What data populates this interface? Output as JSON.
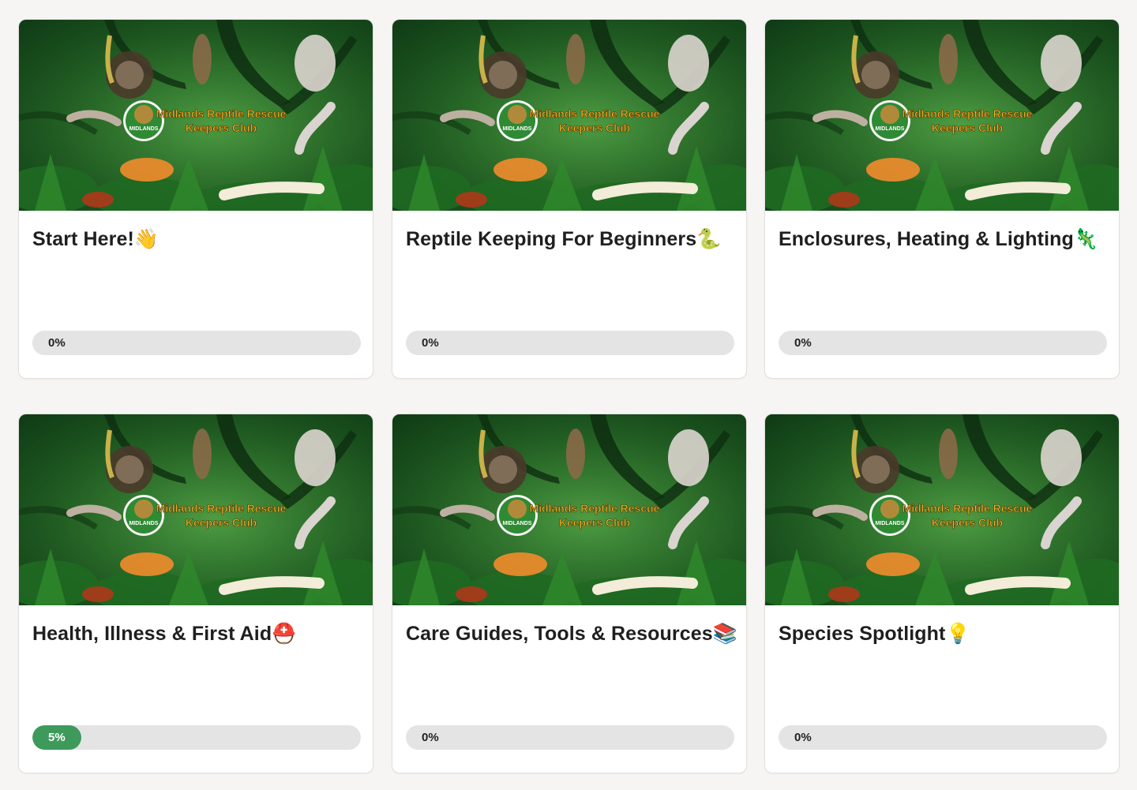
{
  "colors": {
    "page_bg": "#f6f5f4",
    "progress_fill": "#3d9a5b",
    "progress_track": "#e4e4e4",
    "banner_green": "#2a6e29",
    "banner_text": "#f0b429"
  },
  "banner": {
    "line1": "Midlands Reptile Rescue",
    "line2": "Keepers Club",
    "badge_text": "MIDLANDS"
  },
  "courses": [
    {
      "title": "Start Here!👋",
      "progress_label": "0%",
      "progress": 0
    },
    {
      "title": "Reptile Keeping For Beginners🐍",
      "progress_label": "0%",
      "progress": 0
    },
    {
      "title": "Enclosures, Heating & Lighting🦎",
      "progress_label": "0%",
      "progress": 0
    },
    {
      "title": "Health, Illness & First Aid⛑️",
      "progress_label": "5%",
      "progress": 0.05
    },
    {
      "title": "Care Guides, Tools & Resources📚",
      "progress_label": "0%",
      "progress": 0
    },
    {
      "title": "Species Spotlight💡",
      "progress_label": "0%",
      "progress": 0
    }
  ]
}
